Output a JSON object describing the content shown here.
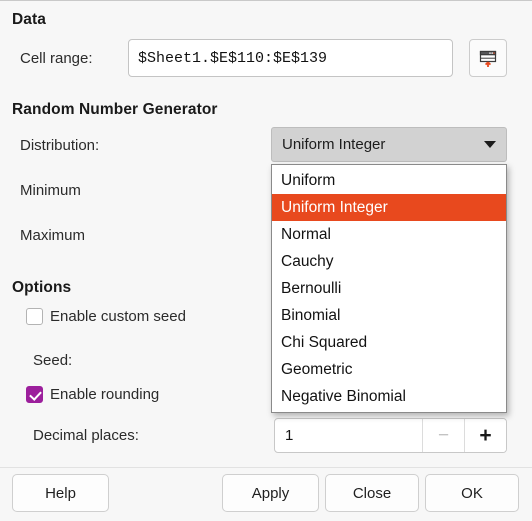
{
  "data_section": {
    "title": "Data",
    "cell_range_label": "Cell range:",
    "cell_range_value": "$Sheet1.$E$110:$E$139",
    "shrink_button_icon": "select-range-icon"
  },
  "generator_section": {
    "title": "Random Number Generator",
    "distribution_label": "Distribution:",
    "distribution_value": "Uniform Integer",
    "minimum_label": "Minimum",
    "maximum_label": "Maximum",
    "dropdown_open": true,
    "dropdown_items": [
      "Uniform",
      "Uniform Integer",
      "Normal",
      "Cauchy",
      "Bernoulli",
      "Binomial",
      "Chi Squared",
      "Geometric",
      "Negative Binomial"
    ],
    "dropdown_selected_index": 1,
    "highlight_color": "#e8491e"
  },
  "options_section": {
    "title": "Options",
    "enable_custom_seed_label": "Enable custom seed",
    "enable_custom_seed_checked": false,
    "seed_label": "Seed:",
    "enable_rounding_label": "Enable rounding",
    "enable_rounding_checked": true,
    "checkbox_accent": "#9c1f9c",
    "decimal_places_label": "Decimal places:",
    "decimal_places_value": "1",
    "decrement_label": "−",
    "increment_label": "+"
  },
  "buttons": {
    "help": "Help",
    "apply": "Apply",
    "close": "Close",
    "ok": "OK"
  }
}
